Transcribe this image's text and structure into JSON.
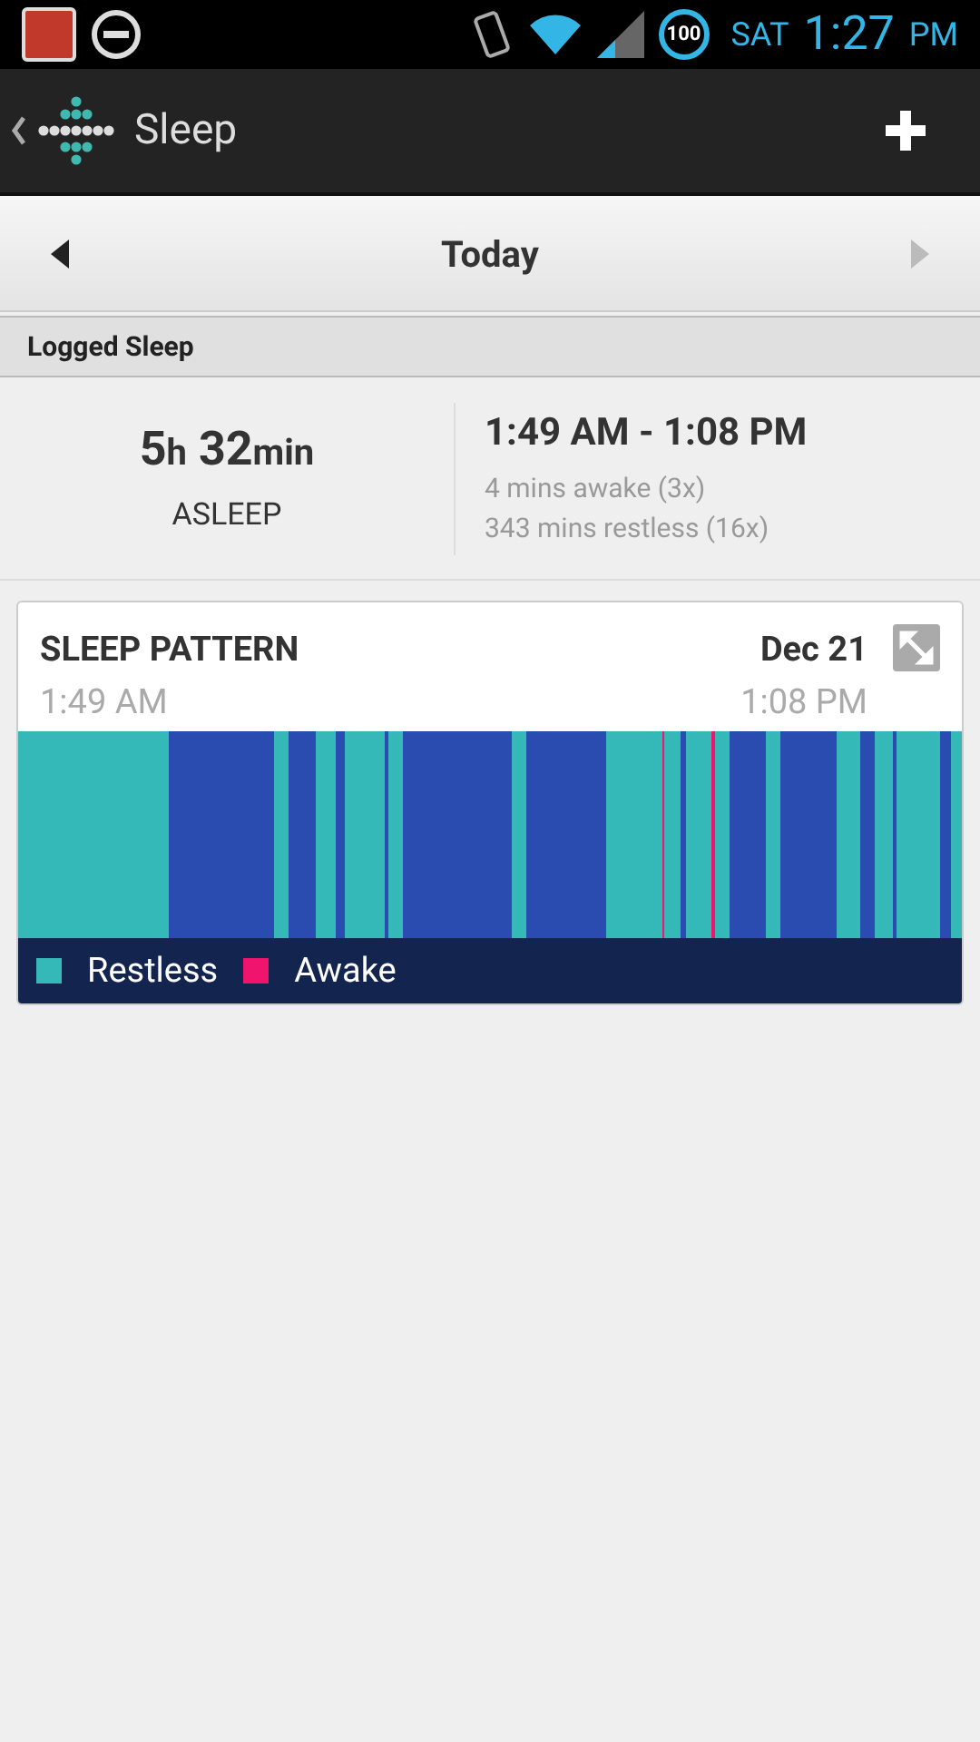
{
  "status_bar": {
    "battery": "100",
    "day": "SAT",
    "time": "1:27",
    "ampm": "PM"
  },
  "app_bar": {
    "title": "Sleep"
  },
  "date_nav": {
    "label": "Today"
  },
  "section": {
    "title": "Logged Sleep"
  },
  "summary": {
    "hours": "5",
    "hours_unit": "h",
    "minutes": "32",
    "minutes_unit": "min",
    "state": "ASLEEP",
    "range": "1:49 AM - 1:08 PM",
    "awake": "4 mins awake (3x)",
    "restless": "343 mins restless (16x)"
  },
  "card": {
    "title": "SLEEP PATTERN",
    "date": "Dec 21",
    "start": "1:49 AM",
    "end": "1:08 PM",
    "legend": [
      {
        "label": "Restless",
        "color": "#35b8b8"
      },
      {
        "label": "Awake",
        "color": "#f0146e"
      }
    ]
  }
}
